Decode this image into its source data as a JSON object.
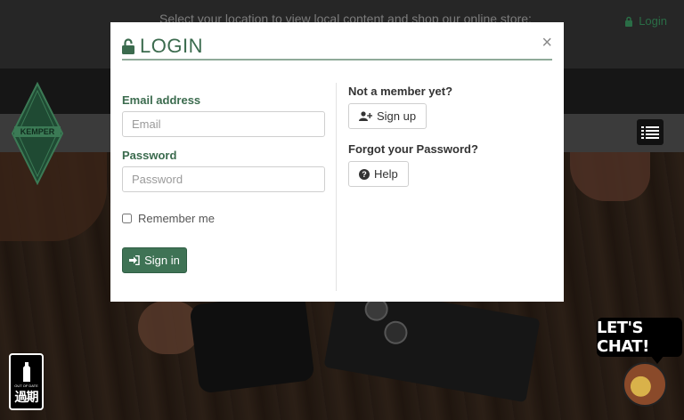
{
  "background": {
    "topbar_text": "Select your location to view local content and shop our online store:",
    "topbar_login": "Login",
    "logo_text": "KEMPER",
    "badge_text": "過期",
    "badge_small": "OUT OF DATE",
    "chat_label": "LET'S CHAT!"
  },
  "modal": {
    "title": "LOGIN",
    "close_symbol": "×",
    "email": {
      "label": "Email address",
      "placeholder": "Email",
      "value": ""
    },
    "password": {
      "label": "Password",
      "placeholder": "Password",
      "value": ""
    },
    "remember_label": "Remember me",
    "remember_checked": false,
    "signin_label": "Sign in",
    "not_member_title": "Not a member yet?",
    "signup_label": "Sign up",
    "forgot_title": "Forgot your Password?",
    "help_label": "Help"
  },
  "colors": {
    "brand_green": "#3b6b4e",
    "button_green": "#3f7355",
    "header_rule": "#8faa99"
  },
  "icons": [
    "lock-open-icon",
    "close-icon",
    "user-plus-icon",
    "question-circle-icon",
    "sign-in-icon",
    "hamburger-menu-icon"
  ]
}
